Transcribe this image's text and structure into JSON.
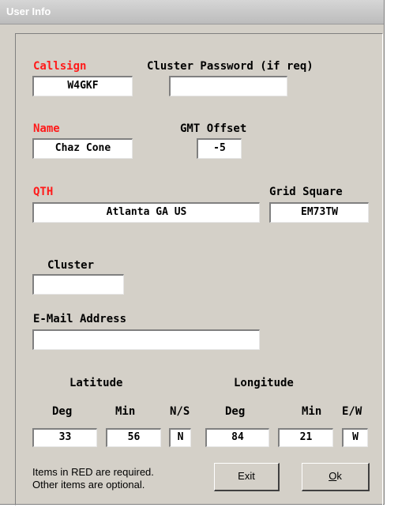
{
  "window": {
    "title": "User Info"
  },
  "callsign": {
    "label": "Callsign",
    "value": "W4GKF"
  },
  "cluster_password": {
    "label": "Cluster Password (if req)",
    "value": ""
  },
  "name": {
    "label": "Name",
    "value": "Chaz Cone"
  },
  "gmt_offset": {
    "label": "GMT Offset",
    "value": "-5"
  },
  "qth": {
    "label": "QTH",
    "value": "Atlanta GA US"
  },
  "grid_square": {
    "label": "Grid Square",
    "value": "EM73TW"
  },
  "cluster": {
    "label": "Cluster",
    "value": ""
  },
  "email": {
    "label": "E-Mail Address",
    "value": ""
  },
  "latitude": {
    "label": "Latitude",
    "deg_label": "Deg",
    "min_label": "Min",
    "ns_label": "N/S",
    "deg": "33",
    "min": "56",
    "ns": "N"
  },
  "longitude": {
    "label": "Longitude",
    "deg_label": "Deg",
    "min_label": "Min",
    "ew_label": "E/W",
    "deg": "84",
    "min": "21",
    "ew": "W"
  },
  "notes": {
    "line1": "Items in RED are required.",
    "line2": "Other items are optional."
  },
  "buttons": {
    "exit": "Exit",
    "ok": "Ok"
  },
  "colors": {
    "required": "#ff1a1a",
    "dialog_bg": "#d4d0c8"
  }
}
